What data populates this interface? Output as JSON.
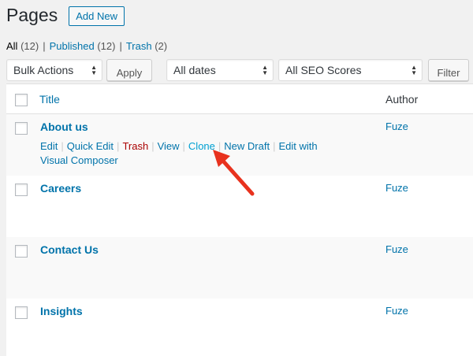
{
  "header": {
    "title": "Pages",
    "add_new": "Add New"
  },
  "views": {
    "all": {
      "label": "All",
      "count": "(12)"
    },
    "published": {
      "label": "Published",
      "count": "(12)"
    },
    "trash": {
      "label": "Trash",
      "count": "(2)"
    },
    "separator": "|"
  },
  "tablenav": {
    "bulk_actions": "Bulk Actions",
    "apply": "Apply",
    "dates": "All dates",
    "seo": "All SEO Scores",
    "filter": "Filter"
  },
  "table": {
    "columns": {
      "title": "Title",
      "author": "Author"
    },
    "rows": [
      {
        "title": "About us",
        "author": "Fuze"
      },
      {
        "title": "Careers",
        "author": "Fuze"
      },
      {
        "title": "Contact Us",
        "author": "Fuze"
      },
      {
        "title": "Insights",
        "author": "Fuze"
      }
    ],
    "row_actions": {
      "edit": "Edit",
      "quick_edit": "Quick Edit",
      "trash": "Trash",
      "view": "View",
      "clone": "Clone",
      "new_draft": "New Draft",
      "edit_with": "Edit with",
      "visual_composer": "Visual Composer",
      "separator": "|"
    }
  },
  "colors": {
    "link": "#0073aa",
    "trash": "#aa0000",
    "highlight": "#00a0d2",
    "annotation_arrow": "#e8321e"
  },
  "icons": {
    "select_arrow": "updown-chevron-icon",
    "annotation": "red-arrow-icon"
  }
}
